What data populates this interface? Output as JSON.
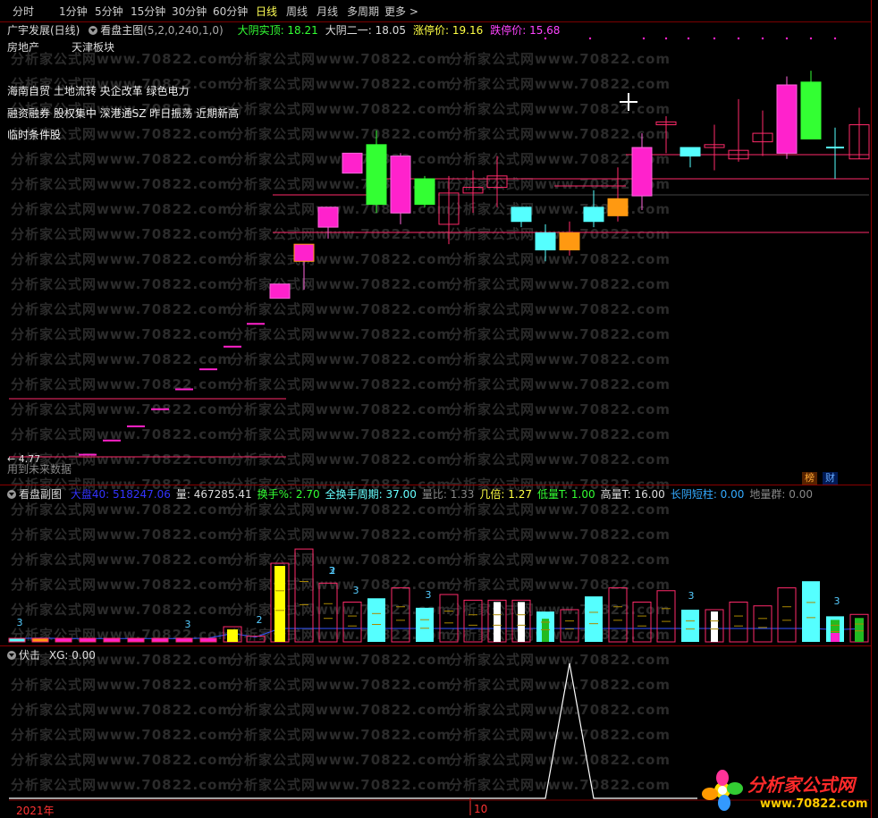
{
  "toolbar": {
    "items": [
      "分时",
      "1分钟",
      "5分钟",
      "15分钟",
      "30分钟",
      "60分钟",
      "日线",
      "周线",
      "月线",
      "多周期",
      "更多 >"
    ],
    "active_index": 6
  },
  "main": {
    "stock": "广宇发展(日线)",
    "indicator": "看盘主图",
    "params": "(5,2,0,240,1,0)",
    "fields": [
      {
        "label": "大阴实顶: 18.21",
        "color": "#33ff33"
      },
      {
        "label": "大阴二一: 18.05",
        "color": "#dddddd"
      },
      {
        "label": "涨停价: 19.16",
        "color": "#ffff44"
      },
      {
        "label": "跌停价: 15.68",
        "color": "#ff44ff"
      }
    ],
    "sector_left": "房地产",
    "sector_right": "天津板块",
    "concepts_1": "海南自贸 土地流转 央企改革 绿色电力",
    "concepts_2": "融资融券 股权集中 深港通SZ 昨日振荡 近期新高",
    "concepts_3": "临时条件股",
    "low_price": "← 4.77",
    "future_text": "用到未来数据",
    "badge_1": "榜",
    "badge_2": "财"
  },
  "volume_panel": {
    "title": "看盘副图",
    "fields": [
      {
        "label": "大盘40: 518247.06",
        "color": "#3333ff"
      },
      {
        "label": "量: 467285.41",
        "color": "#dddddd"
      },
      {
        "label": "换手%: 2.70",
        "color": "#33ff33"
      },
      {
        "label": "全换手周期: 37.00",
        "color": "#66ffff"
      },
      {
        "label": "量比: 1.33",
        "color": "#888888"
      },
      {
        "label": "几倍: 1.27",
        "color": "#ffff44"
      },
      {
        "label": "低量T: 1.00",
        "color": "#33ff33"
      },
      {
        "label": "高量T: 16.00",
        "color": "#dddddd"
      },
      {
        "label": "长阴短柱: 0.00",
        "color": "#33aaff"
      },
      {
        "label": "地量群: 0.00",
        "color": "#888888"
      }
    ],
    "marks": [
      "3",
      "3",
      "2",
      "3",
      "3",
      "3",
      "3",
      "3",
      "2"
    ]
  },
  "xg_panel": {
    "title": "伏击",
    "field": "XG: 0.00"
  },
  "axis": {
    "year": "2021年",
    "month": "10"
  },
  "logo": {
    "name": "分析家公式网",
    "url": "www.70822.com"
  },
  "watermark": "分析家公式网www.70822.com",
  "colors": {
    "up": "#ff2a6a",
    "down_cyan": "#55ffff",
    "down_green": "#33ff33",
    "magenta": "#ff22cc",
    "orange": "#ff9911",
    "frame": "#8a0000"
  }
}
